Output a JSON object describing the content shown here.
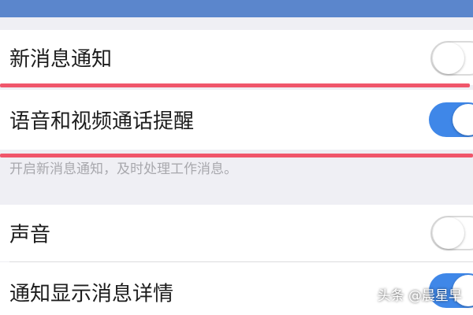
{
  "settings": {
    "new_message_notify": {
      "label": "新消息通知",
      "enabled": false
    },
    "voice_video_reminder": {
      "label": "语音和视频通话提醒",
      "enabled": true
    },
    "hint": "开启新消息通知，及时处理工作消息。",
    "sound": {
      "label": "声音",
      "enabled": false
    },
    "show_details": {
      "label": "通知显示消息详情",
      "enabled": true
    }
  },
  "watermark": "头条 @晨星早",
  "colors": {
    "accent": "#3f87e8",
    "highlight": "#f0566b",
    "header": "#5b86cc"
  }
}
